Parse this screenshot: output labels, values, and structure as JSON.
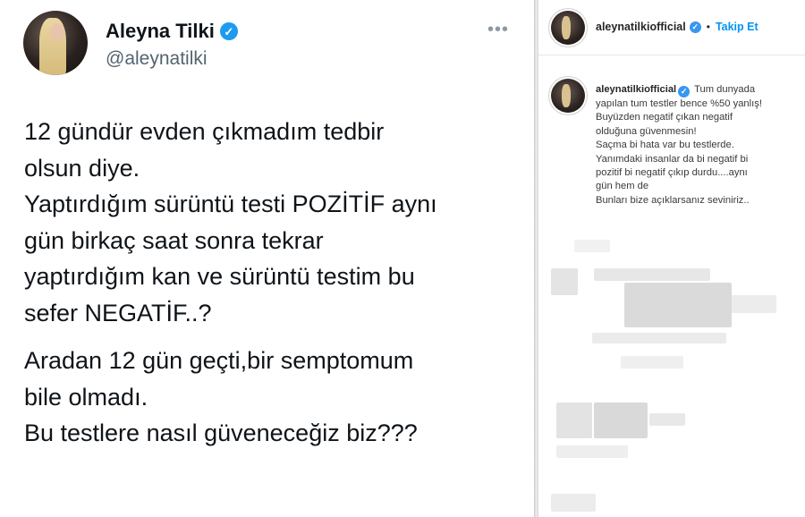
{
  "tweet": {
    "name": "Aleyna Tilki",
    "handle": "@aleynatilki",
    "more_label": "•••",
    "verified_glyph": "✓",
    "paragraphs": [
      [
        "12 gündür evden çıkmadım tedbir",
        "olsun diye.",
        "Yaptırdığım sürüntü testi POZİTİF aynı",
        "gün birkaç saat sonra tekrar",
        "yaptırdığım kan ve sürüntü testim bu",
        "sefer NEGATİF..?"
      ],
      [
        "Aradan 12 gün geçti,bir semptomum",
        "bile olmadı.",
        "Bu testlere nasıl güveneceğiz biz???"
      ]
    ]
  },
  "instagram": {
    "header": {
      "username": "aleynatilkiofficial",
      "separator": "•",
      "follow_label": "Takip Et"
    },
    "caption": {
      "username": "aleynatilkiofficial",
      "first_line_text": "Tum dunyada",
      "lines": [
        "yapılan tum testler bence %50 yanlış!",
        "Buyüzden negatif çıkan negatif",
        "olduğuna güvenmesin!",
        "Saçma bi hata var bu testlerde.",
        "Yanımdaki insanlar da bi negatif bi",
        "pozitif bi negatif çıkıp durdu....aynı",
        "gün hem de",
        "Bunları bize açıklarsanız seviniriz.."
      ]
    }
  },
  "colors": {
    "verified_blue": "#1d9bf0",
    "follow_blue": "#0095f6",
    "handle_gray": "#536471"
  }
}
